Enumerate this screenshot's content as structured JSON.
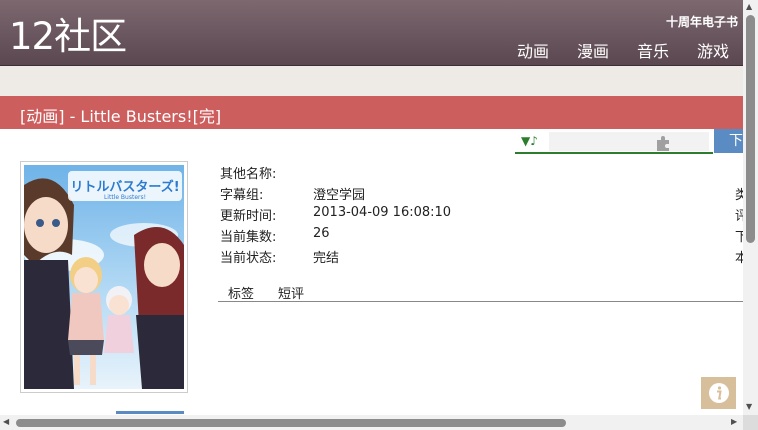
{
  "header": {
    "logo": "12社区",
    "top_link": "十周年电子书",
    "nav": [
      "动画",
      "漫画",
      "音乐",
      "游戏"
    ]
  },
  "title": "[动画] - Little Busters![完]",
  "player": {
    "music_icon": "music-note-icon",
    "plugin_icon": "puzzle-plugin-icon",
    "download_label": "下"
  },
  "cover": {
    "logo_text": "リトルバスターズ!",
    "logo_subtext": "Little Busters!"
  },
  "info": [
    {
      "label": "其他名称:",
      "value": ""
    },
    {
      "label": "字幕组:",
      "value": "澄空学园"
    },
    {
      "label": "更新时间:",
      "value": "2013-04-09 16:08:10"
    },
    {
      "label": "当前集数:",
      "value": "26"
    },
    {
      "label": "当前状态:",
      "value": "完结"
    }
  ],
  "cut_off_right": [
    "类",
    "评",
    "下",
    "本"
  ],
  "tabs": [
    "标签",
    "短评"
  ],
  "info_button_icon": "info-icon",
  "colors": {
    "header": "#6b5760",
    "title_bar": "#cd5e5e",
    "accent_blue": "#5a8cc3",
    "player_green": "#2e7d2e"
  }
}
